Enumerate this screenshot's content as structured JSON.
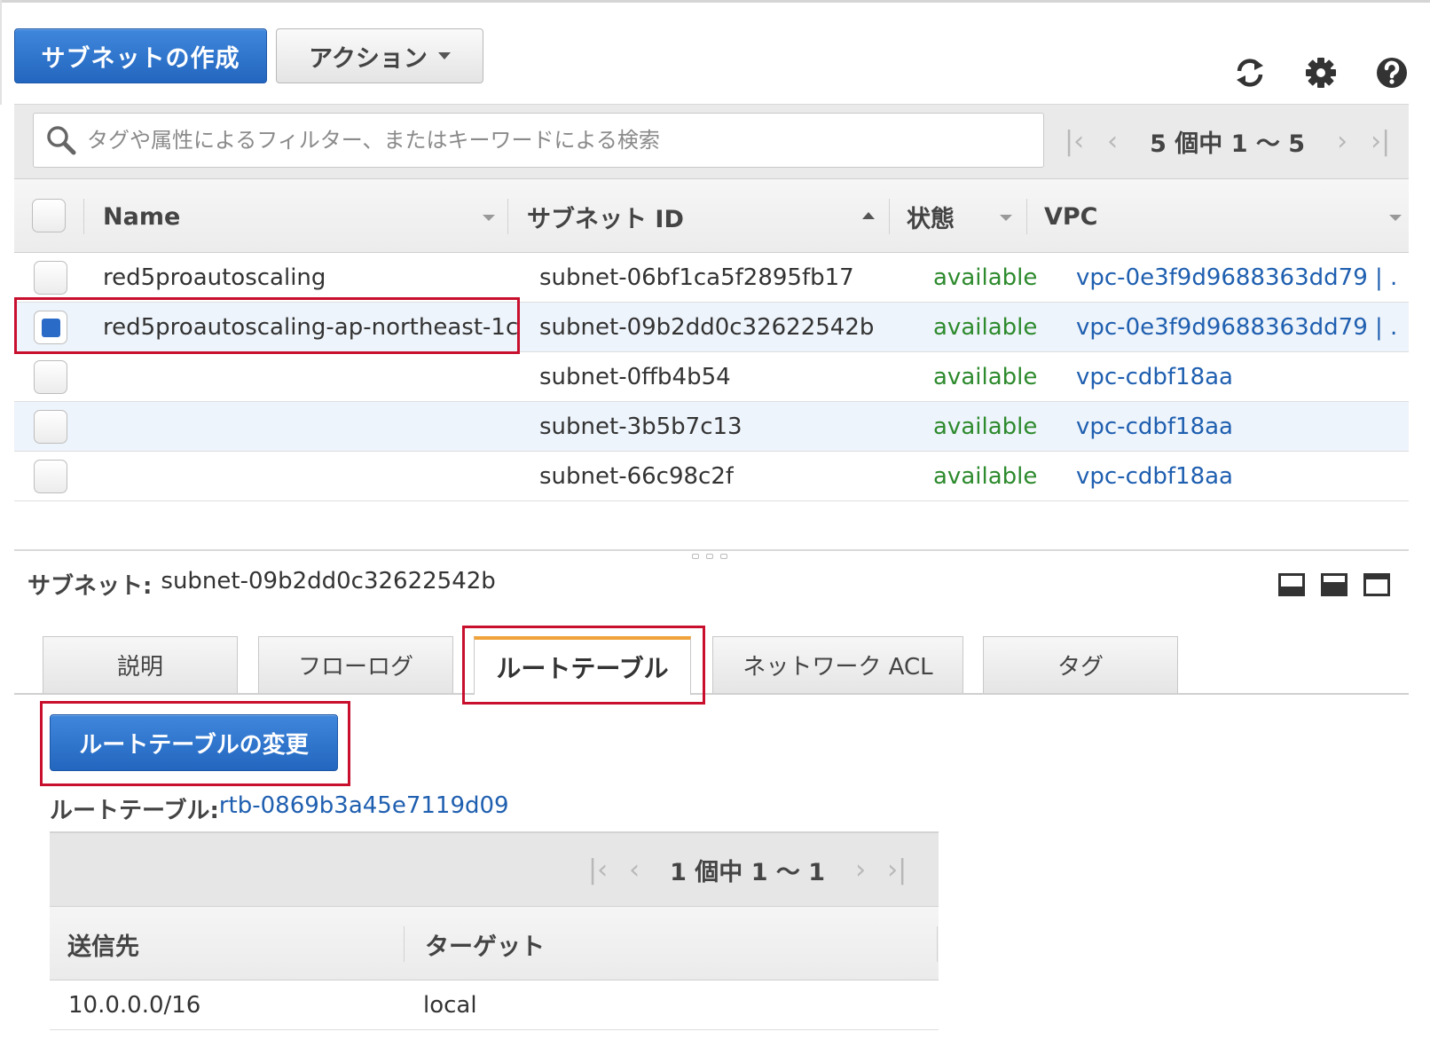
{
  "toolbar": {
    "create_label": "サブネットの作成",
    "action_label": "アクション"
  },
  "filter": {
    "placeholder": "タグや属性によるフィルター、またはキーワードによる検索"
  },
  "pager_top": {
    "text": "5 個中 1 〜 5"
  },
  "table": {
    "columns": [
      "Name",
      "サブネット ID",
      "状態",
      "VPC"
    ],
    "rows": [
      {
        "name": "red5proautoscaling",
        "subnet_id": "subnet-06bf1ca5f2895fb17",
        "state": "available",
        "vpc": "vpc-0e3f9d9688363dd79 | ...",
        "checked": false
      },
      {
        "name": "red5proautoscaling-ap-northeast-1c",
        "subnet_id": "subnet-09b2dd0c32622542b",
        "state": "available",
        "vpc": "vpc-0e3f9d9688363dd79 | ...",
        "checked": true
      },
      {
        "name": "",
        "subnet_id": "subnet-0ffb4b54",
        "state": "available",
        "vpc": "vpc-cdbf18aa",
        "checked": false
      },
      {
        "name": "",
        "subnet_id": "subnet-3b5b7c13",
        "state": "available",
        "vpc": "vpc-cdbf18aa",
        "checked": false
      },
      {
        "name": "",
        "subnet_id": "subnet-66c98c2f",
        "state": "available",
        "vpc": "vpc-cdbf18aa",
        "checked": false
      }
    ]
  },
  "detail": {
    "title_label": "サブネット:",
    "title_value": "subnet-09b2dd0c32622542b",
    "tabs": [
      "説明",
      "フローログ",
      "ルートテーブル",
      "ネットワーク ACL",
      "タグ"
    ],
    "active_tab": 2,
    "edit_route_label": "ルートテーブルの変更",
    "route_table_label": "ルートテーブル:",
    "route_table_id": "rtb-0869b3a45e7119d09",
    "pager_text": "1 個中 1 〜 1",
    "route_columns": [
      "送信先",
      "ターゲット"
    ],
    "routes": [
      {
        "destination": "10.0.0.0/16",
        "target": "local"
      }
    ]
  },
  "colors": {
    "primary": "#2a6bc8",
    "available": "#2d8a2d",
    "link": "#1f5fb0",
    "highlight": "#c8102e",
    "tab_accent": "#f0a33a"
  }
}
